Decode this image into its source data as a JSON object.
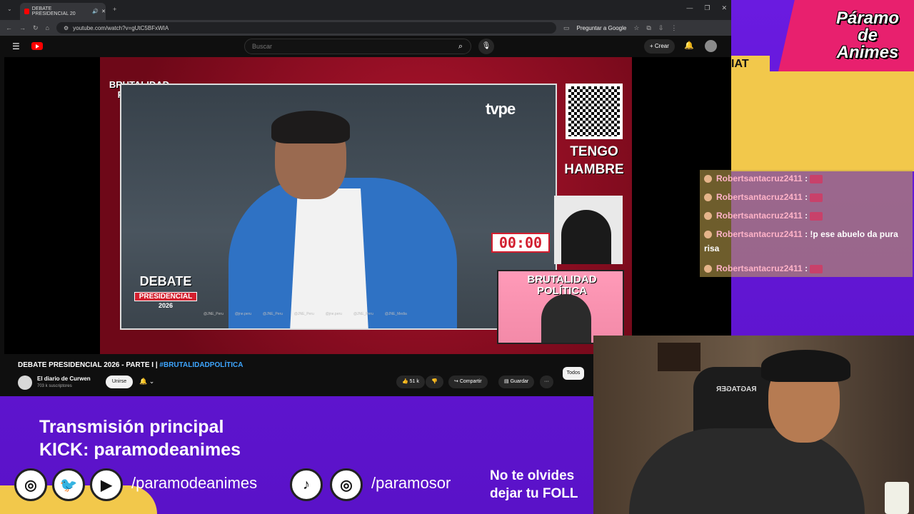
{
  "browser": {
    "tab_title": "DEBATE PRESIDENCIAL 20",
    "url": "youtube.com/watch?v=gUtC5BFxWIA",
    "ask_google": "Preguntar a Google"
  },
  "youtube": {
    "search_placeholder": "Buscar",
    "create_label": "Crear",
    "video_title": "DEBATE PRESIDENCIAL 2026 - PARTE I | ",
    "video_hashtag": "#BRUTALIDADPOLÍTICA",
    "channel_name": "El diario de Curwen",
    "channel_subs": "703 k suscriptores",
    "join_label": "Unirse",
    "likes": "51 k",
    "share_label": "Compartir",
    "save_label": "Guardar",
    "more_label": "···",
    "filter_all": "Todos"
  },
  "stream_video": {
    "brand_logo": "BRUTALIDAD POLÍTICA",
    "tv_logo": "tvpe",
    "debate_line1": "DEBATE",
    "debate_line2": "PRESIDENCIAL",
    "debate_line3": "2026",
    "qr_caption": "TENGO HAMBRE",
    "timer": "00:00",
    "mini_cam_text": "BRUTALIDAD POLÍTICA",
    "footer_handles": [
      "@JNE_Peru",
      "@jne.peru",
      "@JNE_Peru",
      "@JNE_Peru",
      "@jne.peru",
      "@JNE_Peru",
      "@JNE_Media"
    ]
  },
  "overlay": {
    "logo_line1": "Páramo",
    "logo_line2": "de",
    "logo_line3": "Animes",
    "chat_tab": "IAT",
    "main_stream_line1": "Transmisión principal",
    "main_stream_line2": "KICK: paramodeanimes",
    "handle_1": "/paramodeanimes",
    "handle_2": "/paramosor",
    "follow_line1": "No te olvides",
    "follow_line2": "dejar tu FOLL",
    "chair_brand": "RAGTAGER"
  },
  "chat": {
    "messages": [
      {
        "user": "Robertsantacruz2411",
        "sep": " : ",
        "text": ""
      },
      {
        "user": "Robertsantacruz2411",
        "sep": " : ",
        "text": ""
      },
      {
        "user": "Robertsantacruz2411",
        "sep": " : ",
        "text": ""
      },
      {
        "user": "Robertsantacruz2411",
        "sep": " : ",
        "text": "!p ese abuelo da pura risa"
      },
      {
        "user": "Robertsantacruz2411",
        "sep": " : ",
        "text": ""
      }
    ]
  },
  "colors": {
    "overlay_purple": "#6a1be0",
    "accent_pink": "#e8206e",
    "accent_yellow": "#f2c84b",
    "youtube_red": "#ff0000",
    "link_blue": "#3ea6ff"
  }
}
